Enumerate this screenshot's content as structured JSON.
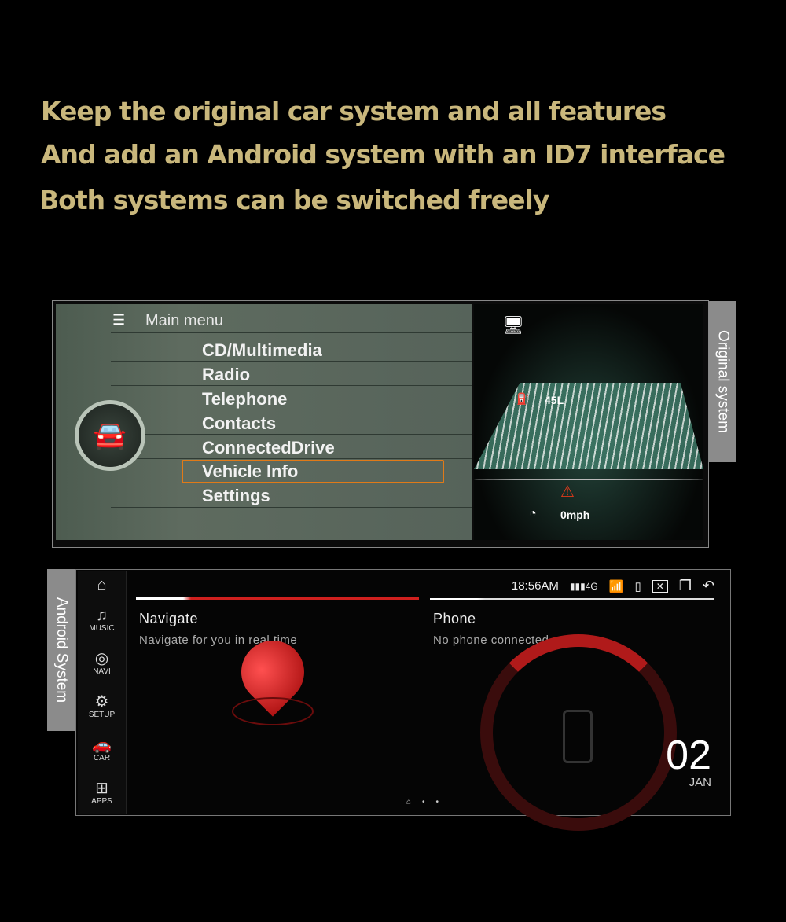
{
  "headline": [
    "Keep the original car system and all features",
    "And add an Android system with  an ID7 interface",
    "Both systems can be switched freely"
  ],
  "original": {
    "tab_label": "Original system",
    "menu_title": "Main menu",
    "menu_items": [
      "CD/Multimedia",
      "Radio",
      "Telephone",
      "Contacts",
      "ConnectedDrive",
      "Vehicle Info",
      "Settings"
    ],
    "selected": "Vehicle Info",
    "fuel": "45L",
    "speed": "0mph",
    "accent": "#e07a18"
  },
  "android": {
    "tab_label": "Android System",
    "sidebar": [
      {
        "icon": "home-icon",
        "label": ""
      },
      {
        "icon": "music-icon",
        "label": "MUSIC"
      },
      {
        "icon": "navi-icon",
        "label": "NAVI"
      },
      {
        "icon": "setup-icon",
        "label": "SETUP"
      },
      {
        "icon": "car-icon",
        "label": "CAR"
      },
      {
        "icon": "apps-icon",
        "label": "APPS"
      }
    ],
    "status": {
      "time": "18:56AM",
      "signal": "4G"
    },
    "navigate": {
      "title": "Navigate",
      "subtitle": "Navigate for you in real time"
    },
    "phone": {
      "title": "Phone",
      "subtitle": "No phone connected"
    },
    "date": {
      "day": "02",
      "month": "JAN"
    },
    "accent": "#d0201e"
  }
}
